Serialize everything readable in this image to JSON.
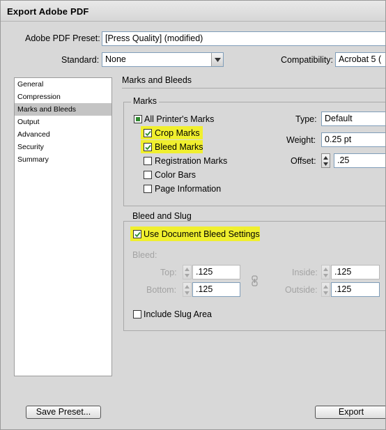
{
  "window": {
    "title": "Export Adobe PDF"
  },
  "header": {
    "preset_label": "Adobe PDF Preset:",
    "preset_value": "[Press Quality] (modified)",
    "standard_label": "Standard:",
    "standard_value": "None",
    "compat_label": "Compatibility:",
    "compat_value": "Acrobat 5 ("
  },
  "sidebar": {
    "items": [
      {
        "label": "General"
      },
      {
        "label": "Compression"
      },
      {
        "label": "Marks and Bleeds",
        "selected": true
      },
      {
        "label": "Output"
      },
      {
        "label": "Advanced"
      },
      {
        "label": "Security"
      },
      {
        "label": "Summary"
      }
    ]
  },
  "main": {
    "section_title": "Marks and Bleeds",
    "marks": {
      "title": "Marks",
      "all_printers_marks": {
        "label": "All Printer's Marks",
        "state": "partial"
      },
      "crop_marks": {
        "label": "Crop Marks",
        "checked": true
      },
      "bleed_marks": {
        "label": "Bleed Marks",
        "checked": true
      },
      "registration_marks": {
        "label": "Registration Marks",
        "checked": false
      },
      "color_bars": {
        "label": "Color Bars",
        "checked": false
      },
      "page_information": {
        "label": "Page Information",
        "checked": false
      },
      "type_label": "Type:",
      "type_value": "Default",
      "weight_label": "Weight:",
      "weight_value": "0.25 pt",
      "offset_label": "Offset:",
      "offset_value": ".25"
    },
    "bleed_slug": {
      "title": "Bleed and Slug",
      "use_doc_bleed": {
        "label": "Use Document Bleed Settings",
        "checked": true
      },
      "bleed_label": "Bleed:",
      "top_label": "Top:",
      "top_value": ".125",
      "bottom_label": "Bottom:",
      "bottom_value": ".125",
      "inside_label": "Inside:",
      "inside_value": ".125",
      "outside_label": "Outside:",
      "outside_value": ".125",
      "include_slug": {
        "label": "Include Slug Area",
        "checked": false
      }
    }
  },
  "footer": {
    "save_preset_label": "Save Preset...",
    "export_label": "Export"
  },
  "colors": {
    "highlight": "#f0ef2e",
    "check_green": "#2f8a2f"
  }
}
